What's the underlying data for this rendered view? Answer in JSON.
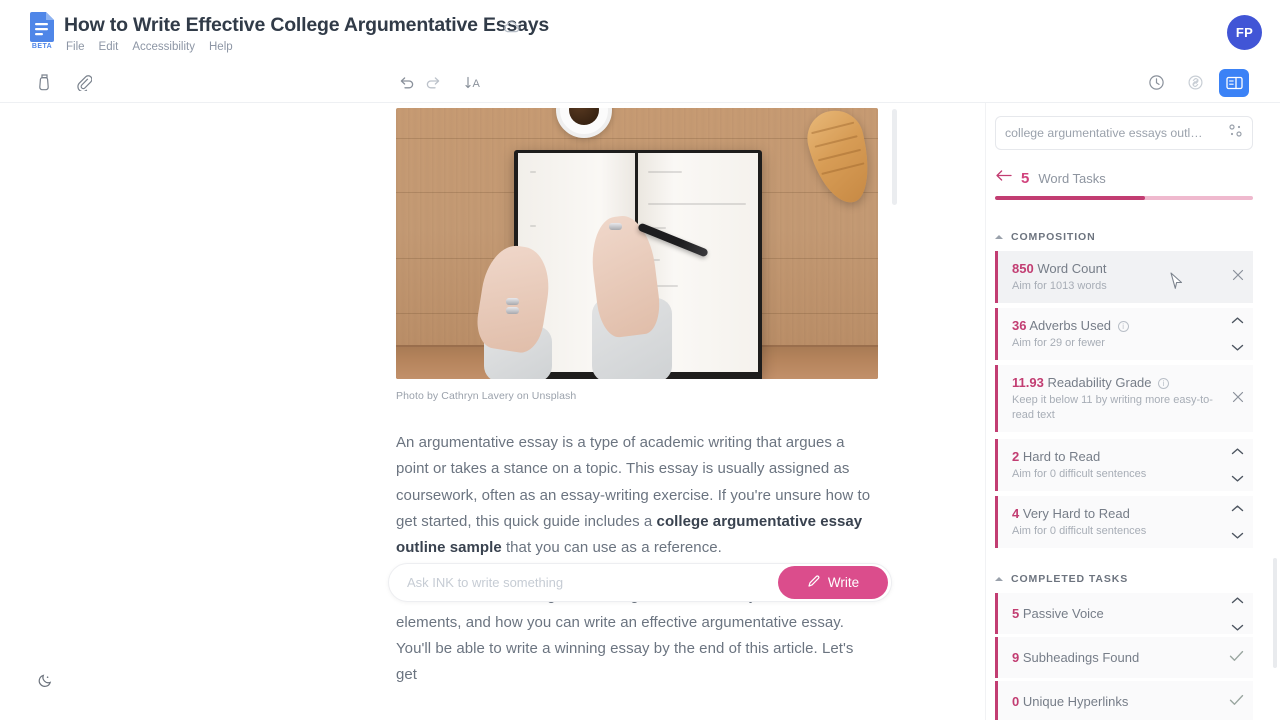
{
  "app": {
    "brand_badge": "BETA",
    "doc_title": "How to Write Effective College Argumentative Essays",
    "avatar_initials": "FP"
  },
  "menubar": {
    "items": [
      {
        "label": "File"
      },
      {
        "label": "Edit"
      },
      {
        "label": "Accessibility"
      },
      {
        "label": "Help"
      }
    ]
  },
  "toolbar": {
    "ink_icon": "ink-bottle-icon",
    "attach_icon": "paperclip-icon",
    "undo_icon": "undo-icon",
    "redo_icon": "redo-icon",
    "format_icon": "text-format-icon",
    "history_icon": "history-clock-icon",
    "link_icon": "link-icon",
    "panel_icon": "side-panel-icon"
  },
  "document": {
    "image_caption": "Photo by Cathryn Lavery on Unsplash",
    "paragraph1_pre": "An argumentative essay is a type of academic writing that argues a point or takes a stance on a topic. This essay is usually assigned as coursework, often as an essay-writing exercise. If you're unsure how to get started, this quick guide includes a ",
    "paragraph1_bold": "college argumentative essay outline sample",
    "paragraph1_post": " that you can use as a reference.",
    "paragraph2": "We'll also be discussing what an argumentative essay is, its main elements, and how you can write an effective argumentative essay. You'll be able to write a winning essay by the end of this article. Let's get"
  },
  "writebar": {
    "placeholder": "Ask INK to write something",
    "button_label": "Write",
    "button_icon": "pen-icon",
    "button_color": "#db4d8c"
  },
  "darkmode": {
    "icon": "moon-icon"
  },
  "panel": {
    "search": {
      "value": "college argumentative essays outl…",
      "icon": "settings-sliders-icon"
    },
    "header": {
      "back_icon": "arrow-left-icon",
      "count": "5",
      "label": "Word Tasks",
      "progress_percent": 58,
      "progress_fill_color": "#c23d72",
      "progress_track_color": "#efb9ce"
    },
    "sections": [
      {
        "title": "COMPOSITION",
        "tasks": [
          {
            "num": "850",
            "title": "Word Count",
            "sub": "Aim for 1013 words",
            "action": "close",
            "info": false,
            "hovered": true
          },
          {
            "num": "36",
            "title": "Adverbs Used",
            "sub": "Aim for 29 or fewer",
            "action": "chevrons",
            "info": true,
            "hovered": false
          },
          {
            "num": "11.93",
            "title": "Readability Grade",
            "sub": "Keep it below 11 by writing more easy-to-read text",
            "action": "close",
            "info": true,
            "hovered": false
          },
          {
            "num": "2",
            "title": "Hard to Read",
            "sub": "Aim for 0 difficult sentences",
            "action": "chevrons",
            "info": false,
            "hovered": false
          },
          {
            "num": "4",
            "title": "Very Hard to Read",
            "sub": "Aim for 0 difficult sentences",
            "action": "chevrons",
            "info": false,
            "hovered": false
          }
        ]
      },
      {
        "title": "COMPLETED TASKS",
        "tasks": [
          {
            "num": "5",
            "title": "Passive Voice",
            "sub": "",
            "action": "chevrons",
            "info": false,
            "hovered": false
          },
          {
            "num": "9",
            "title": "Subheadings Found",
            "sub": "",
            "action": "check",
            "info": false,
            "hovered": false
          },
          {
            "num": "0",
            "title": "Unique Hyperlinks",
            "sub": "",
            "action": "check",
            "info": false,
            "hovered": false
          }
        ]
      }
    ]
  }
}
